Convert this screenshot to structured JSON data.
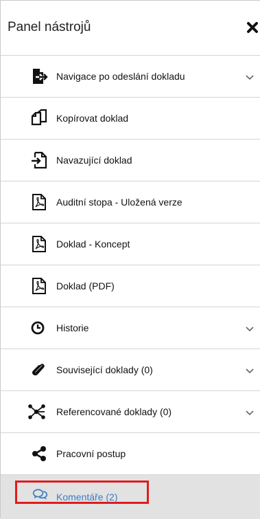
{
  "panel": {
    "title": "Panel nástrojů",
    "close_icon": "close-icon"
  },
  "items": [
    {
      "label": "Navigace po odeslání dokladu",
      "icon": "file-export-icon",
      "expandable": true
    },
    {
      "label": "Kopírovat doklad",
      "icon": "copy-icon",
      "expandable": false
    },
    {
      "label": "Navazující doklad",
      "icon": "file-arrow-icon",
      "expandable": false
    },
    {
      "label": "Auditní stopa - Uložená verze",
      "icon": "pdf-icon",
      "expandable": false
    },
    {
      "label": "Doklad - Koncept",
      "icon": "pdf-icon",
      "expandable": false
    },
    {
      "label": "Doklad (PDF)",
      "icon": "pdf-icon",
      "expandable": false
    },
    {
      "label": "Historie",
      "icon": "clock-icon",
      "expandable": true
    },
    {
      "label": "Související doklady (0)",
      "icon": "paperclip-icon",
      "expandable": true
    },
    {
      "label": "Referencované doklady (0)",
      "icon": "network-icon",
      "expandable": true
    },
    {
      "label": "Pracovní postup",
      "icon": "share-icon",
      "expandable": false
    },
    {
      "label": "Komentáře (2)",
      "icon": "comments-icon",
      "expandable": false,
      "active": true,
      "highlighted": true
    }
  ],
  "colors": {
    "active_text": "#3b7cc4",
    "active_bg": "#e2e2e2",
    "highlight_border": "#e31a1c"
  }
}
